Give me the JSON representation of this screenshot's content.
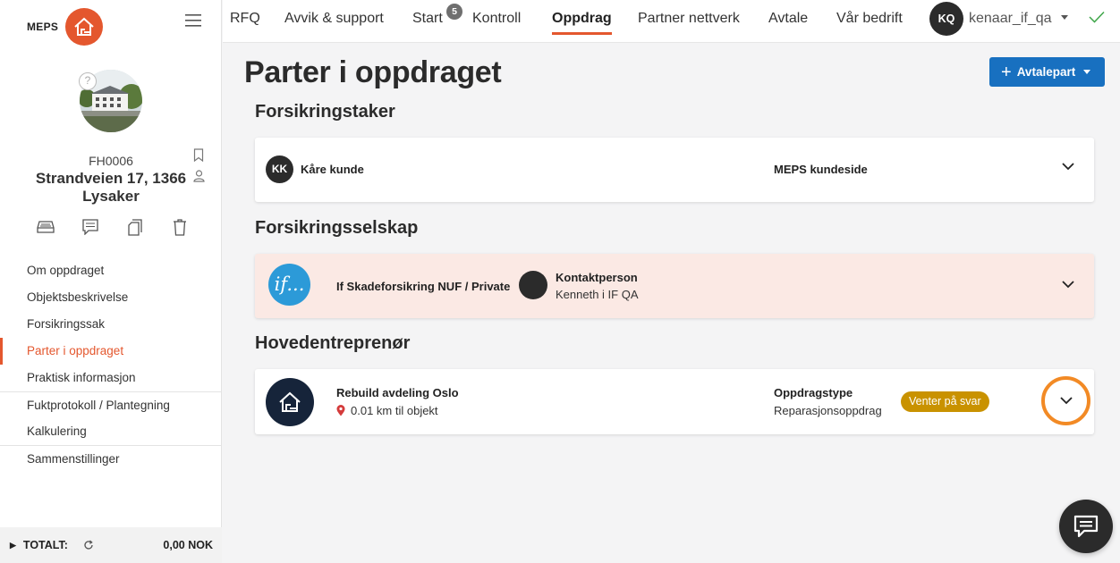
{
  "brand": {
    "name": "MEPS",
    "accent": "#e4572e"
  },
  "sidebar": {
    "object_id": "FH0006",
    "address": "Strandveien 17, 1366 Lysaker",
    "action_icons": [
      "drawer-icon",
      "comment-icon",
      "copy-icon",
      "trash-icon"
    ],
    "nav": [
      {
        "label": "Om oppdraget",
        "active": false
      },
      {
        "label": "Objektsbeskrivelse",
        "active": false
      },
      {
        "label": "Forsikringssak",
        "active": false
      },
      {
        "label": "Parter i oppdraget",
        "active": true
      },
      {
        "label": "Praktisk informasjon",
        "active": false
      },
      {
        "label": "Fuktprotokoll / Plantegning",
        "active": false
      },
      {
        "label": "Kalkulering",
        "active": false
      },
      {
        "label": "Sammenstillinger",
        "active": false
      }
    ],
    "total": {
      "label": "TOTALT:",
      "value": "0,00 NOK"
    }
  },
  "topnav": {
    "items": [
      "RFQ",
      "Avvik & support",
      "Start",
      "Kontroll",
      "Oppdrag",
      "Partner nettverk",
      "Avtale",
      "Vår bedrift"
    ],
    "active": "Oppdrag",
    "start_badge": "5",
    "user": {
      "initials": "KQ",
      "name": "kenaar_if_qa"
    }
  },
  "main": {
    "title": "Parter i oppdraget",
    "add_button": "Avtalepart",
    "sections": {
      "policyholder": {
        "title": "Forsikringstaker",
        "initials": "KK",
        "name": "Kåre kunde",
        "link": "MEPS kundeside"
      },
      "insurer": {
        "title": "Forsikringsselskap",
        "logo_text": "if...",
        "name": "If Skadeforsikring NUF / Private",
        "contact_label": "Kontaktperson",
        "contact_name": "Kenneth i IF QA"
      },
      "contractor": {
        "title": "Hovedentreprenør",
        "name": "Rebuild avdeling Oslo",
        "distance": "0.01 km til objekt",
        "type_label": "Oppdragstype",
        "type_value": "Reparasjonsoppdrag",
        "status": "Venter på svar"
      }
    }
  }
}
